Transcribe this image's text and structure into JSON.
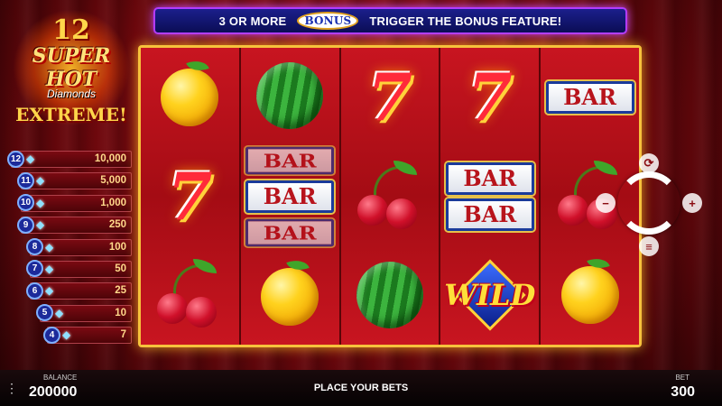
{
  "banner": {
    "left_text": "3 OR MORE",
    "badge": "BONUS",
    "right_text": "TRIGGER THE BONUS FEATURE!"
  },
  "logo": {
    "number": "12",
    "line1": "SUPER HOT",
    "line2": "Diamonds",
    "line3": "EXTREME!"
  },
  "paytable": [
    {
      "count": "12",
      "amount": "10,000"
    },
    {
      "count": "11",
      "amount": "5,000"
    },
    {
      "count": "10",
      "amount": "1,000"
    },
    {
      "count": "9",
      "amount": "250"
    },
    {
      "count": "8",
      "amount": "100"
    },
    {
      "count": "7",
      "amount": "50"
    },
    {
      "count": "6",
      "amount": "25"
    },
    {
      "count": "5",
      "amount": "10"
    },
    {
      "count": "4",
      "amount": "7"
    }
  ],
  "reels": [
    [
      "orange",
      "seven",
      "cherry"
    ],
    [
      "watermelon",
      "bar-stack",
      "orange"
    ],
    [
      "seven",
      "cherry",
      "watermelon"
    ],
    [
      "seven",
      "bar-double",
      "wild"
    ],
    [
      "bar",
      "cherry",
      "orange"
    ]
  ],
  "symbols": {
    "bar_text": "BAR",
    "wild_text": "WILD",
    "seven_text": "7"
  },
  "controls": {
    "plus": "+",
    "minus": "−",
    "menu": "≡",
    "auto": "⟳"
  },
  "bottom": {
    "menu_icon": "⋮",
    "balance_label": "BALANCE",
    "balance_value": "200000",
    "status": "PLACE YOUR BETS",
    "bet_label": "BET",
    "bet_value": "300"
  },
  "colors": {
    "accent_gold": "#f6c23c",
    "banner_border": "#b23cff",
    "reel_red": "#b10d14"
  }
}
